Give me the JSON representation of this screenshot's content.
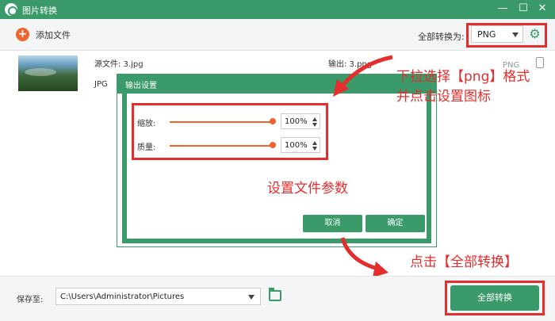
{
  "window": {
    "title": "图片转换",
    "minimize_icon": "—",
    "maximize_icon": "☐",
    "close_icon": "✕"
  },
  "toolbar": {
    "add_label": "添加文件",
    "add_icon": "+",
    "convert_all_label": "全部转换为:",
    "format_value": "PNG",
    "gear_icon": "⚙"
  },
  "file": {
    "source_label": "源文件: 3.jpg",
    "source_format": "JPG",
    "output_label": "输出: 3.png",
    "output_format": "PNG"
  },
  "dialog": {
    "title": "输出设置",
    "scale_label": "缩放:",
    "scale_value": "100%",
    "quality_label": "质量:",
    "quality_value": "100%",
    "cancel_label": "取消",
    "ok_label": "确定",
    "scale_level": 1.0,
    "quality_level": 1.0
  },
  "annotations": {
    "top_line1": "下拉选择【png】格式",
    "top_line2": "并点击设置图标",
    "middle": "设置文件参数",
    "bottom": "点击【全部转换】"
  },
  "bottom": {
    "save_label": "保存至:",
    "path_value": "C:\\Users\\Administrator\\Pictures",
    "convert_button": "全部转换"
  },
  "colors": {
    "brand_green": "#3a9a6a",
    "accent_orange": "#f0632c",
    "highlight_red": "#e42d2d"
  }
}
